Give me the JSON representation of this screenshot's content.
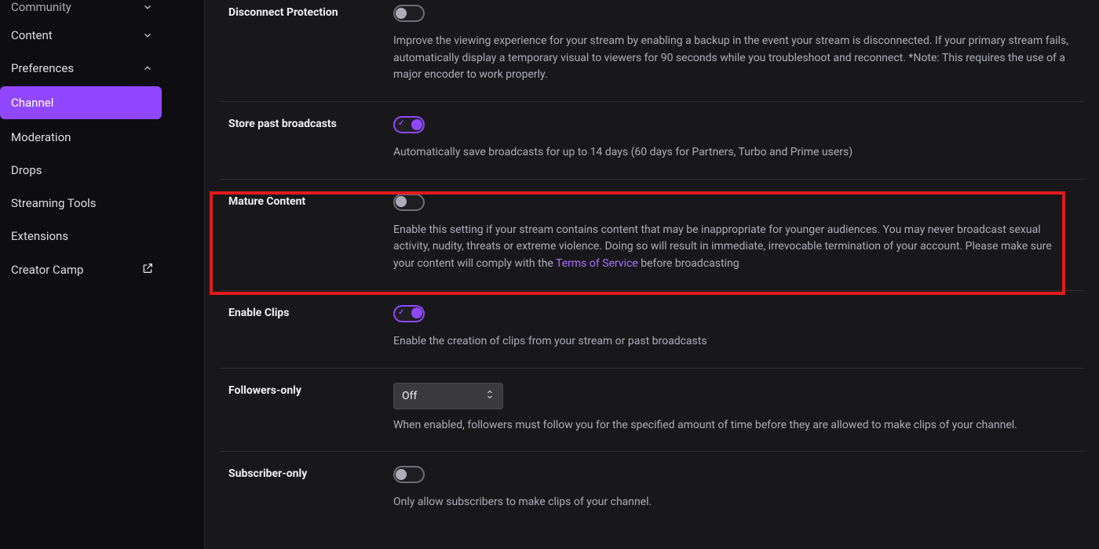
{
  "sidebar": {
    "items": [
      {
        "label": "Community",
        "icon": "chevron-down"
      },
      {
        "label": "Content",
        "icon": "chevron-down"
      },
      {
        "label": "Preferences",
        "icon": "chevron-up"
      },
      {
        "label": "Channel",
        "active": true
      },
      {
        "label": "Moderation"
      },
      {
        "label": "Drops"
      },
      {
        "label": "Streaming Tools"
      },
      {
        "label": "Extensions"
      },
      {
        "label": "Creator Camp",
        "icon": "external"
      }
    ]
  },
  "settings": {
    "disconnect": {
      "title": "Disconnect Protection",
      "state": "off",
      "desc": "Improve the viewing experience for your stream by enabling a backup in the event your stream is disconnected. If your primary stream fails, automatically display a temporary visual to viewers for 90 seconds while you troubleshoot and reconnect. *Note: This requires the use of a major encoder to work properly."
    },
    "store": {
      "title": "Store past broadcasts",
      "state": "on",
      "desc": "Automatically save broadcasts for up to 14 days (60 days for Partners, Turbo and Prime users)"
    },
    "mature": {
      "title": "Mature Content",
      "state": "off",
      "desc_pre": "Enable this setting if your stream contains content that may be inappropriate for younger audiences. You may never broadcast sexual activity, nudity, threats or extreme violence. Doing so will result in immediate, irrevocable termination of your account. Please make sure your content will comply with the ",
      "link": "Terms of Service",
      "desc_post": " before broadcasting"
    },
    "clips": {
      "title": "Enable Clips",
      "state": "on",
      "desc": "Enable the creation of clips from your stream or past broadcasts"
    },
    "followers": {
      "title": "Followers-only",
      "value": "Off",
      "desc": "When enabled, followers must follow you for the specified amount of time before they are allowed to make clips of your channel."
    },
    "subscriber": {
      "title": "Subscriber-only",
      "state": "off",
      "desc": "Only allow subscribers to make clips of your channel."
    }
  }
}
